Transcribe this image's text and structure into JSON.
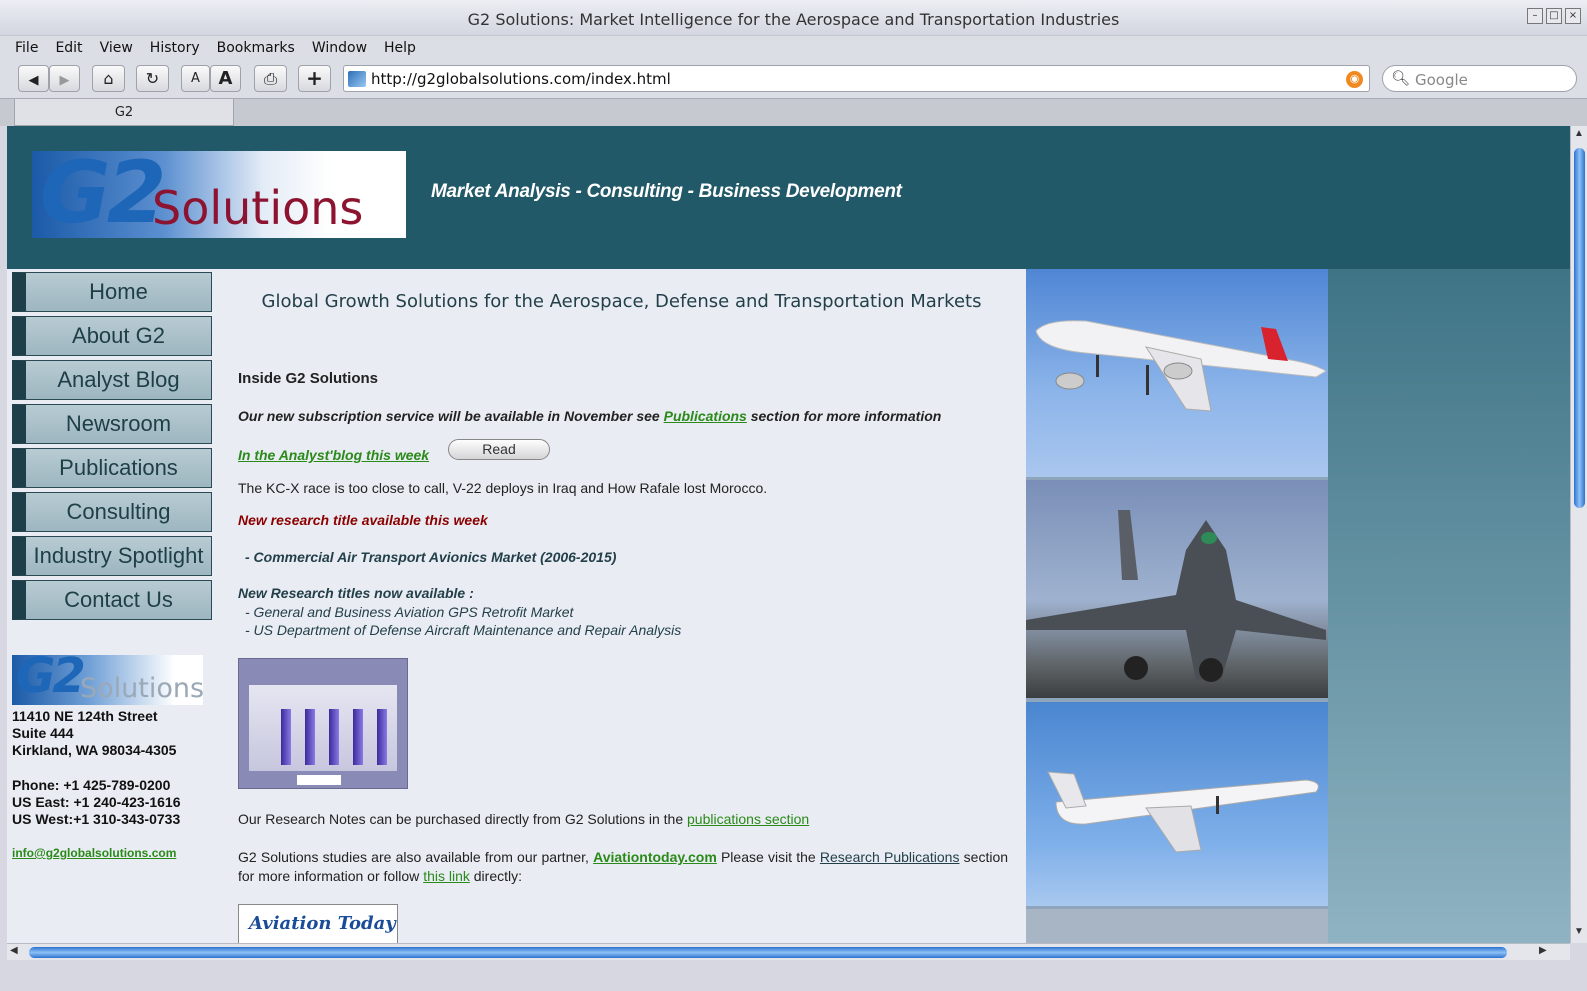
{
  "window": {
    "title": "G2 Solutions: Market Intelligence for the Aerospace and Transportation Industries",
    "buttons": [
      "minimize-icon",
      "maximize-icon",
      "close-icon"
    ]
  },
  "menubar": {
    "items": [
      "File",
      "Edit",
      "View",
      "History",
      "Bookmarks",
      "Window",
      "Help"
    ]
  },
  "toolbar": {
    "back_icon": "◀",
    "forward_icon": "▶",
    "home_icon": "⌂",
    "reload_icon": "↻",
    "text_smaller": "A",
    "text_bigger": "A",
    "print_icon": "⎙",
    "add_bookmark": "+",
    "url": "http://g2globalsolutions.com/index.html",
    "search_placeholder": "Google"
  },
  "tab": {
    "label": "G2"
  },
  "header": {
    "logo_g2": "G2",
    "logo_solutions": "Solutions",
    "tagline": "Market Analysis - Consulting - Business Development"
  },
  "nav": {
    "items": [
      "Home",
      "About G2",
      "Analyst Blog",
      "Newsroom",
      "Publications",
      "Consulting",
      "Industry Spotlight",
      "Contact Us"
    ]
  },
  "contact": {
    "logo_g2": "G2",
    "logo_solutions": "Solutions",
    "street": "11410 NE 124th Street",
    "suite": "Suite 444",
    "city": "Kirkland, WA 98034-4305",
    "phone": "Phone:  +1  425-789-0200",
    "us_east": "US East: +1  240-423-1616",
    "us_west": "US West:+1  310-343-0733",
    "email": "info@g2globalsolutions.com"
  },
  "main": {
    "headline": "Global Growth Solutions for the Aerospace, Defense and Transportation Markets",
    "inside_title": "Inside G2 Solutions",
    "subscription_pre": "Our new subscription service will be available in November see ",
    "subscription_link": "Publications",
    "subscription_post": " section for more information",
    "blog_link": "In the Analyst'blog this week",
    "read_button": "Read",
    "blog_summary": "The KC-X race is too close to call,  V-22 deploys in Iraq and How Rafale lost Morocco.",
    "new_research": "New research title available this week",
    "new_title": "-  Commercial Air Transport Avionics Market (2006-2015)",
    "titles_heading": "New Research titles now available :",
    "titles": [
      "-   General and Business Aviation GPS Retrofit Market",
      "-   US Department of Defense Aircraft Maintenance and Repair Analysis"
    ],
    "purchase_pre": "Our Research Notes can be purchased directly from G2 Solutions in the ",
    "purchase_link": "publications section ",
    "partner_pre": "G2  Solutions  studies  are  also  available  from  our  partner, ",
    "partner_link": "Aviationtoday.com",
    "partner_mid": "   Please  visit  the ",
    "research_pubs_link": "Research Publications",
    "partner_post1": " section for more information or follow ",
    "this_link": "this link",
    "partner_post2": " directly:",
    "aviation_today_logo": "Aviation Today"
  },
  "colors": {
    "page_bg": "#225968",
    "content_bg": "#e9ecf2",
    "nav_button": "#9db6c0",
    "link_green": "#2a8a1a",
    "accent_red": "#8b0000"
  }
}
